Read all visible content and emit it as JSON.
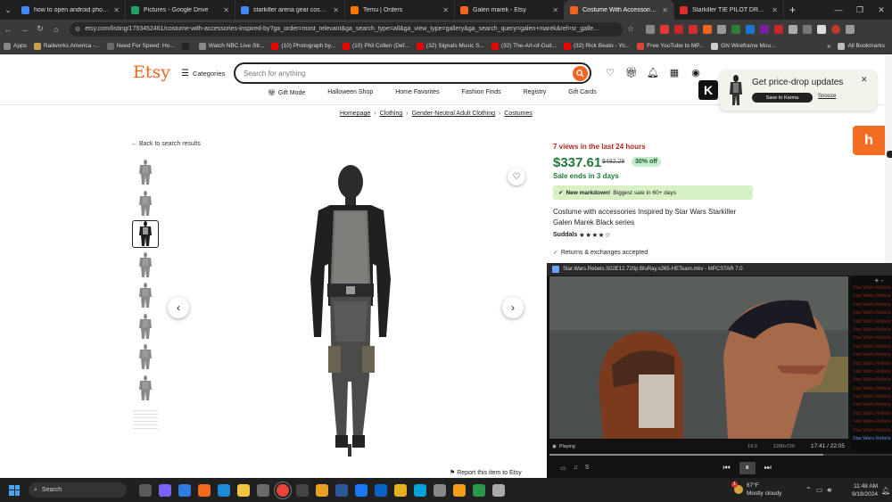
{
  "browser": {
    "tabs": [
      {
        "title": "how to open android photo ga",
        "color": "#4285f4"
      },
      {
        "title": "Pictures - Google Drive",
        "color": "#1fa463"
      },
      {
        "title": "starkiller arena gear cosplay - G",
        "color": "#4285f4"
      },
      {
        "title": "Temu | Orders",
        "color": "#fb7701"
      },
      {
        "title": "Galen marek - Etsy",
        "color": "#f1641e"
      },
      {
        "title": "Costume With Accessories Insp",
        "color": "#f1641e"
      },
      {
        "title": "Starkiller TIE PILOT DRESS - Sta",
        "color": "#d93025"
      }
    ],
    "active_tab": 5,
    "new_tab": "+",
    "url": "etsy.com/listing/1753452461/costume-with-accessories-inspired-by?ga_order=most_relevant&ga_search_type=all&ga_view_type=gallery&ga_search_query=galen+marek&ref=sr_galle...",
    "bookmarks": [
      {
        "label": "Apps",
        "color": "#888"
      },
      {
        "label": "Railworks America -...",
        "color": "#c4a24a"
      },
      {
        "label": "Need For Speed: Ho...",
        "color": "#6a6a6a"
      },
      {
        "label": "",
        "color": "#222"
      },
      {
        "label": "Watch NBC Live Str...",
        "color": "#888"
      },
      {
        "label": "(10) Photograph by...",
        "color": "#e00"
      },
      {
        "label": "(10) Phil Collen (Def...",
        "color": "#e00"
      },
      {
        "label": "(32) Signals Music S...",
        "color": "#e00"
      },
      {
        "label": "(32) The-Art-of-Guit...",
        "color": "#e00"
      },
      {
        "label": "(32) Rick Beato - Yo...",
        "color": "#e00"
      },
      {
        "label": "Free YouTube to MP...",
        "color": "#d43"
      },
      {
        "label": "GN Wireframe Mou...",
        "color": "#ccc"
      }
    ],
    "all_bookmarks": "All Bookmarks"
  },
  "etsy": {
    "logo": "Etsy",
    "categories": "Categories",
    "search_placeholder": "Search for anything",
    "subnav": [
      "Gift Mode",
      "Halloween Shop",
      "Home Favorites",
      "Fashion Finds",
      "Registry",
      "Gift Cards"
    ],
    "breadcrumb": [
      "Homepage",
      "Clothing",
      "Gender-Neutral Adult Clothing",
      "Costumes"
    ],
    "back": "Back to search results",
    "report": "Report this item to Etsy"
  },
  "product": {
    "views": "7 views in the last 24 hours",
    "price": "$337.61",
    "original_price": "$482.29",
    "discount": "30% off",
    "sale_ends": "Sale ends in 3 days",
    "markdown_bold": "New markdown!",
    "markdown_text": "Biggest sale in 60+ days",
    "title": "Costume with accessories Inspired by Star Wars Starkiller Galen Marek Black series",
    "shop": "Suddals",
    "rating_stars": "★★★★☆",
    "returns": "Returns & exchanges accepted",
    "thumbnail_count": 9,
    "selected_thumbnail": 3
  },
  "karma": {
    "title": "Get price-drop updates",
    "button": "Save to Karma",
    "snooze": "Snooze",
    "k": "K"
  },
  "honey": {
    "glyph": "h"
  },
  "player": {
    "title": "Star.Wars.Rebels.S02E12.720p.BluRay.x265-HETeam.mkv - MPCSTAR 7.0",
    "status": "Playing",
    "aspect": "16:9",
    "resolution": "1280x720",
    "time": "17:41 / 22:05",
    "progress": 0.8,
    "playlist_header": "+ -",
    "playlist_item": "Star.Wars.Rebels",
    "playlist_current": "Star.Wars.Rebels"
  },
  "taskbar": {
    "search": "Search",
    "weather_temp": "67°F",
    "weather_desc": "Mostly cloudy",
    "weather_badge": "1",
    "time": "11:48 AM",
    "date": "9/18/2024"
  }
}
